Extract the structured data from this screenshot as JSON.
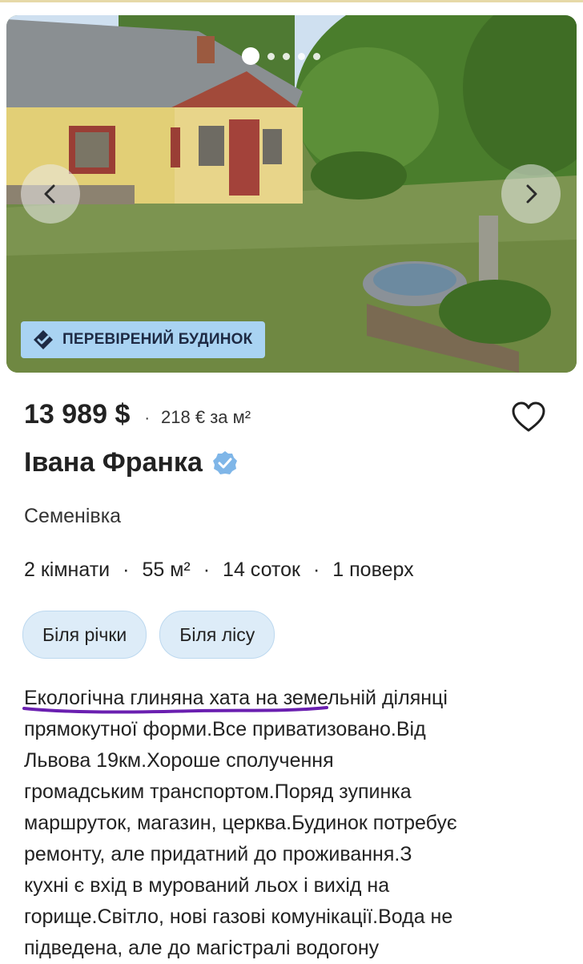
{
  "gallery": {
    "slide_count": 5,
    "active_slide": 1
  },
  "badge": {
    "label": "ПЕРЕВІРЕНИЙ БУДИНОК"
  },
  "listing": {
    "price": "13 989 $",
    "separator": "·",
    "price_per_m2": "218 € за м²",
    "street": "Івана Франка",
    "city": "Семенівка",
    "specs": {
      "rooms": "2 кімнати",
      "area": "55 м²",
      "land": "14 соток",
      "floors": "1 поверх"
    },
    "tags": [
      "Біля річки",
      "Біля лісу"
    ],
    "description_lines": [
      "Екологічна глиняна хата на земельній ділянці",
      "прямокутної форми.Все приватизовано.Від",
      "Львова 19км.Хороше сполучення",
      "громадським транспортом.Поряд зупинка",
      "маршруток, магазин, церква.Будинок потребує",
      "ремонту, але придатний до проживання.З",
      "кухні є вхід в мурований льох і вихід на",
      "горище.Світло, нові газові комунікації.Вода не",
      "підведена, але до магістралі водогону"
    ]
  },
  "colors": {
    "badge_bg": "#a9d3f2",
    "tag_bg": "#ddecf8",
    "verified_check": "#7fb6e8",
    "underline": "#6a1fb0"
  }
}
